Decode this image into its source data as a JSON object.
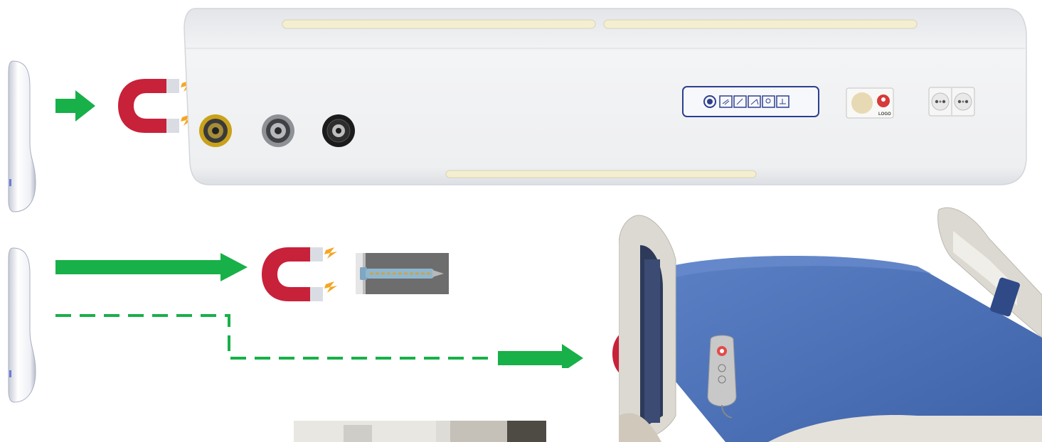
{
  "colors": {
    "arrow_green": "#18b048",
    "magnet_red": "#c8213a",
    "magnet_tip": "#d9dde3",
    "spark_orange": "#f5a623",
    "panel_white": "#f1f2f4",
    "panel_edge": "#d3d6da",
    "light_strip": "#f4efd0",
    "mattress_blue": "#4f74b9",
    "rail_grey": "#dcd9d2",
    "handset_grey": "#c8c8c8",
    "handset_red": "#e24a4a",
    "control_border": "#2e3f8f"
  },
  "icons": [
    "handset-device-icon",
    "green-arrow-icon",
    "horseshoe-magnet-icon",
    "spark-icon",
    "gas-outlet-yellow-icon",
    "gas-outlet-silver-icon",
    "gas-outlet-black-icon",
    "nurse-call-panel-icon",
    "call-button-icon",
    "power-socket-icon",
    "screw-anchor-icon",
    "hospital-bed-icon",
    "bed-handset-icon"
  ],
  "labels": {
    "call_button_text": "LOGO"
  }
}
